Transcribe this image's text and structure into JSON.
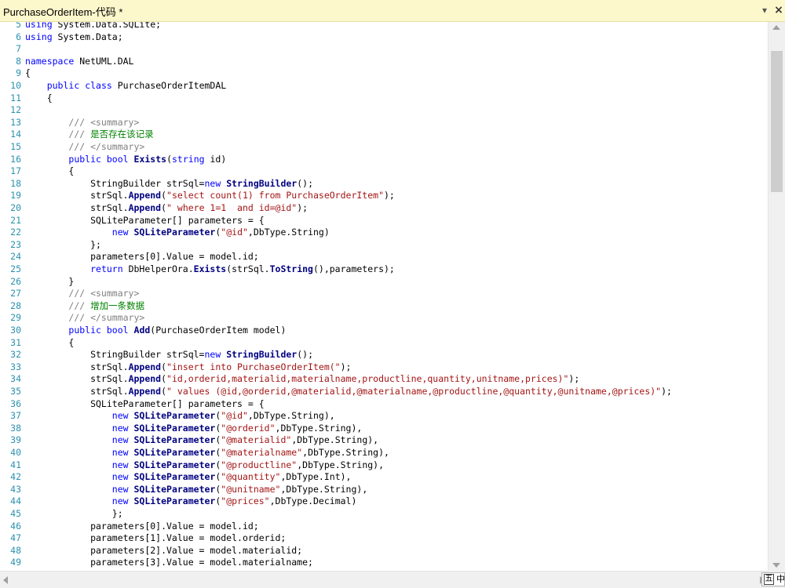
{
  "window": {
    "title": "PurchaseOrderItem-代码 *"
  },
  "icons": {
    "dropdown": "chevron-down-icon",
    "close": "close-icon",
    "ime": "ime-icon"
  },
  "ime": {
    "glyph": "五",
    "label": "中"
  },
  "colors": {
    "keyword": "#0000ff",
    "string": "#a31515",
    "comment": "#008000",
    "line_number": "#2b91af",
    "titlebar": "#fdf7cc"
  },
  "lines": [
    {
      "n": "5",
      "segs": [
        [
          "kw",
          "using"
        ],
        [
          "p",
          " System.Data.SQLite;"
        ]
      ]
    },
    {
      "n": "6",
      "segs": [
        [
          "kw",
          "using"
        ],
        [
          "p",
          " System.Data;"
        ]
      ]
    },
    {
      "n": "7",
      "segs": []
    },
    {
      "n": "8",
      "segs": [
        [
          "kw",
          "namespace"
        ],
        [
          "p",
          " NetUML.DAL"
        ]
      ]
    },
    {
      "n": "9",
      "segs": [
        [
          "p",
          "{"
        ]
      ]
    },
    {
      "n": "10",
      "segs": [
        [
          "p",
          "    "
        ],
        [
          "kw",
          "public"
        ],
        [
          "p",
          " "
        ],
        [
          "kw",
          "class"
        ],
        [
          "p",
          " PurchaseOrderItemDAL"
        ]
      ]
    },
    {
      "n": "11",
      "segs": [
        [
          "p",
          "    {"
        ]
      ]
    },
    {
      "n": "12",
      "segs": []
    },
    {
      "n": "13",
      "segs": [
        [
          "p",
          "        "
        ],
        [
          "doc",
          "/// <summary>"
        ]
      ]
    },
    {
      "n": "14",
      "segs": [
        [
          "p",
          "        "
        ],
        [
          "doc",
          "/// "
        ],
        [
          "cm",
          "是否存在该记录"
        ]
      ]
    },
    {
      "n": "15",
      "segs": [
        [
          "p",
          "        "
        ],
        [
          "doc",
          "/// </summary>"
        ]
      ]
    },
    {
      "n": "16",
      "segs": [
        [
          "p",
          "        "
        ],
        [
          "kw",
          "public"
        ],
        [
          "p",
          " "
        ],
        [
          "kw",
          "bool"
        ],
        [
          "p",
          " "
        ],
        [
          "mt",
          "Exists"
        ],
        [
          "p",
          "("
        ],
        [
          "kw",
          "string"
        ],
        [
          "p",
          " id)"
        ]
      ]
    },
    {
      "n": "17",
      "segs": [
        [
          "p",
          "        {"
        ]
      ]
    },
    {
      "n": "18",
      "segs": [
        [
          "p",
          "            StringBuilder strSql="
        ],
        [
          "kw",
          "new"
        ],
        [
          "p",
          " "
        ],
        [
          "mt",
          "StringBuilder"
        ],
        [
          "p",
          "();"
        ]
      ]
    },
    {
      "n": "19",
      "segs": [
        [
          "p",
          "            strSql."
        ],
        [
          "mt",
          "Append"
        ],
        [
          "p",
          "("
        ],
        [
          "str",
          "\"select count(1) from PurchaseOrderItem\""
        ],
        [
          "p",
          ");"
        ]
      ]
    },
    {
      "n": "20",
      "segs": [
        [
          "p",
          "            strSql."
        ],
        [
          "mt",
          "Append"
        ],
        [
          "p",
          "("
        ],
        [
          "str",
          "\" where 1=1  and id=@id\""
        ],
        [
          "p",
          ");"
        ]
      ]
    },
    {
      "n": "21",
      "segs": [
        [
          "p",
          "            SQLiteParameter[] parameters = {"
        ]
      ]
    },
    {
      "n": "22",
      "segs": [
        [
          "p",
          "                "
        ],
        [
          "kw",
          "new"
        ],
        [
          "p",
          " "
        ],
        [
          "mt",
          "SQLiteParameter"
        ],
        [
          "p",
          "("
        ],
        [
          "str",
          "\"@id\""
        ],
        [
          "p",
          ",DbType.String)"
        ]
      ]
    },
    {
      "n": "23",
      "segs": [
        [
          "p",
          "            };"
        ]
      ]
    },
    {
      "n": "24",
      "segs": [
        [
          "p",
          "            parameters[0].Value = model.id;"
        ]
      ]
    },
    {
      "n": "25",
      "segs": [
        [
          "p",
          "            "
        ],
        [
          "kw",
          "return"
        ],
        [
          "p",
          " DbHelperOra."
        ],
        [
          "mt",
          "Exists"
        ],
        [
          "p",
          "(strSql."
        ],
        [
          "mt",
          "ToString"
        ],
        [
          "p",
          "(),parameters);"
        ]
      ]
    },
    {
      "n": "26",
      "segs": [
        [
          "p",
          "        }"
        ]
      ]
    },
    {
      "n": "27",
      "segs": [
        [
          "p",
          "        "
        ],
        [
          "doc",
          "/// <summary>"
        ]
      ]
    },
    {
      "n": "28",
      "segs": [
        [
          "p",
          "        "
        ],
        [
          "doc",
          "/// "
        ],
        [
          "cm",
          "增加一条数据"
        ]
      ]
    },
    {
      "n": "29",
      "segs": [
        [
          "p",
          "        "
        ],
        [
          "doc",
          "/// </summary>"
        ]
      ]
    },
    {
      "n": "30",
      "segs": [
        [
          "p",
          "        "
        ],
        [
          "kw",
          "public"
        ],
        [
          "p",
          " "
        ],
        [
          "kw",
          "bool"
        ],
        [
          "p",
          " "
        ],
        [
          "mt",
          "Add"
        ],
        [
          "p",
          "(PurchaseOrderItem model)"
        ]
      ]
    },
    {
      "n": "31",
      "segs": [
        [
          "p",
          "        {"
        ]
      ]
    },
    {
      "n": "32",
      "segs": [
        [
          "p",
          "            StringBuilder strSql="
        ],
        [
          "kw",
          "new"
        ],
        [
          "p",
          " "
        ],
        [
          "mt",
          "StringBuilder"
        ],
        [
          "p",
          "();"
        ]
      ]
    },
    {
      "n": "33",
      "segs": [
        [
          "p",
          "            strSql."
        ],
        [
          "mt",
          "Append"
        ],
        [
          "p",
          "("
        ],
        [
          "str",
          "\"insert into PurchaseOrderItem(\""
        ],
        [
          "p",
          ");"
        ]
      ]
    },
    {
      "n": "34",
      "segs": [
        [
          "p",
          "            strSql."
        ],
        [
          "mt",
          "Append"
        ],
        [
          "p",
          "("
        ],
        [
          "str",
          "\"id,orderid,materialid,materialname,productline,quantity,unitname,prices)\""
        ],
        [
          "p",
          ");"
        ]
      ]
    },
    {
      "n": "35",
      "segs": [
        [
          "p",
          "            strSql."
        ],
        [
          "mt",
          "Append"
        ],
        [
          "p",
          "("
        ],
        [
          "str",
          "\" values (@id,@orderid,@materialid,@materialname,@productline,@quantity,@unitname,@prices)\""
        ],
        [
          "p",
          ");"
        ]
      ]
    },
    {
      "n": "36",
      "segs": [
        [
          "p",
          "            SQLiteParameter[] parameters = {"
        ]
      ]
    },
    {
      "n": "37",
      "segs": [
        [
          "p",
          "                "
        ],
        [
          "kw",
          "new"
        ],
        [
          "p",
          " "
        ],
        [
          "mt",
          "SQLiteParameter"
        ],
        [
          "p",
          "("
        ],
        [
          "str",
          "\"@id\""
        ],
        [
          "p",
          ",DbType.String),"
        ]
      ]
    },
    {
      "n": "38",
      "segs": [
        [
          "p",
          "                "
        ],
        [
          "kw",
          "new"
        ],
        [
          "p",
          " "
        ],
        [
          "mt",
          "SQLiteParameter"
        ],
        [
          "p",
          "("
        ],
        [
          "str",
          "\"@orderid\""
        ],
        [
          "p",
          ",DbType.String),"
        ]
      ]
    },
    {
      "n": "39",
      "segs": [
        [
          "p",
          "                "
        ],
        [
          "kw",
          "new"
        ],
        [
          "p",
          " "
        ],
        [
          "mt",
          "SQLiteParameter"
        ],
        [
          "p",
          "("
        ],
        [
          "str",
          "\"@materialid\""
        ],
        [
          "p",
          ",DbType.String),"
        ]
      ]
    },
    {
      "n": "40",
      "segs": [
        [
          "p",
          "                "
        ],
        [
          "kw",
          "new"
        ],
        [
          "p",
          " "
        ],
        [
          "mt",
          "SQLiteParameter"
        ],
        [
          "p",
          "("
        ],
        [
          "str",
          "\"@materialname\""
        ],
        [
          "p",
          ",DbType.String),"
        ]
      ]
    },
    {
      "n": "41",
      "segs": [
        [
          "p",
          "                "
        ],
        [
          "kw",
          "new"
        ],
        [
          "p",
          " "
        ],
        [
          "mt",
          "SQLiteParameter"
        ],
        [
          "p",
          "("
        ],
        [
          "str",
          "\"@productline\""
        ],
        [
          "p",
          ",DbType.String),"
        ]
      ]
    },
    {
      "n": "42",
      "segs": [
        [
          "p",
          "                "
        ],
        [
          "kw",
          "new"
        ],
        [
          "p",
          " "
        ],
        [
          "mt",
          "SQLiteParameter"
        ],
        [
          "p",
          "("
        ],
        [
          "str",
          "\"@quantity\""
        ],
        [
          "p",
          ",DbType.Int),"
        ]
      ]
    },
    {
      "n": "43",
      "segs": [
        [
          "p",
          "                "
        ],
        [
          "kw",
          "new"
        ],
        [
          "p",
          " "
        ],
        [
          "mt",
          "SQLiteParameter"
        ],
        [
          "p",
          "("
        ],
        [
          "str",
          "\"@unitname\""
        ],
        [
          "p",
          ",DbType.String),"
        ]
      ]
    },
    {
      "n": "44",
      "segs": [
        [
          "p",
          "                "
        ],
        [
          "kw",
          "new"
        ],
        [
          "p",
          " "
        ],
        [
          "mt",
          "SQLiteParameter"
        ],
        [
          "p",
          "("
        ],
        [
          "str",
          "\"@prices\""
        ],
        [
          "p",
          ",DbType.Decimal)"
        ]
      ]
    },
    {
      "n": "45",
      "segs": [
        [
          "p",
          "                };"
        ]
      ]
    },
    {
      "n": "46",
      "segs": [
        [
          "p",
          "            parameters[0].Value = model.id;"
        ]
      ]
    },
    {
      "n": "47",
      "segs": [
        [
          "p",
          "            parameters[1].Value = model.orderid;"
        ]
      ]
    },
    {
      "n": "48",
      "segs": [
        [
          "p",
          "            parameters[2].Value = model.materialid;"
        ]
      ]
    },
    {
      "n": "49",
      "segs": [
        [
          "p",
          "            parameters[3].Value = model.materialname;"
        ]
      ]
    }
  ]
}
